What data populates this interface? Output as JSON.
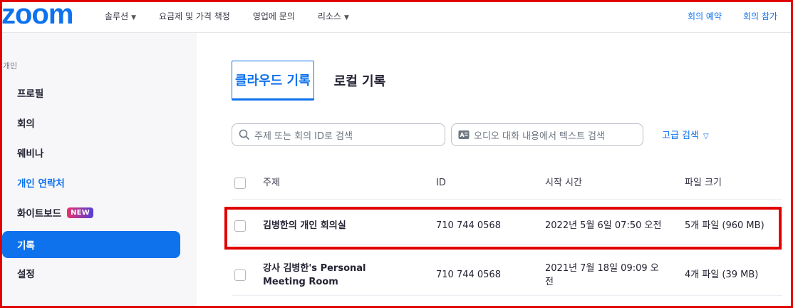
{
  "brand": {
    "logo_text": "zoom",
    "color": "#0e72ed"
  },
  "nav": [
    {
      "label": "솔루션",
      "has_caret": true
    },
    {
      "label": "요금제 및 가격 책정",
      "has_caret": false
    },
    {
      "label": "영업에 문의",
      "has_caret": false
    },
    {
      "label": "리소스",
      "has_caret": true
    }
  ],
  "top_right": {
    "schedule": "회의 예약",
    "join": "회의 참가"
  },
  "sidebar": {
    "section": "개인",
    "items": [
      {
        "label": "프로필"
      },
      {
        "label": "회의"
      },
      {
        "label": "웨비나"
      },
      {
        "label": "개인 연락처"
      },
      {
        "label": "화이트보드",
        "badge": "NEW"
      },
      {
        "label": "기록",
        "active": true
      },
      {
        "label": "설정"
      }
    ]
  },
  "tabs": [
    {
      "label": "클라우드 기록",
      "active": true
    },
    {
      "label": "로컬 기록"
    }
  ],
  "search": {
    "topic_placeholder": "주제 또는 회의 ID로 검색",
    "audio_placeholder": "오디오 대화 내용에서 텍스트 검색",
    "advanced": "고급 검색"
  },
  "table": {
    "headers": {
      "topic": "주제",
      "id": "ID",
      "start_time": "시작 시간",
      "file_size": "파일 크기"
    },
    "rows": [
      {
        "topic": "김병한의 개인 회의실",
        "id": "710 744 0568",
        "start_time": "2022년 5월 6일 07:50 오전",
        "file_size": "5개 파일 (960 MB)"
      },
      {
        "topic": "강사 김병한's Personal Meeting Room",
        "id": "710 744 0568",
        "start_time": "2021년 7월 18일 09:09 오전",
        "file_size": "4개 파일 (39 MB)"
      }
    ]
  },
  "colors": {
    "accent": "#0e72ed",
    "highlight": "#e00000"
  }
}
